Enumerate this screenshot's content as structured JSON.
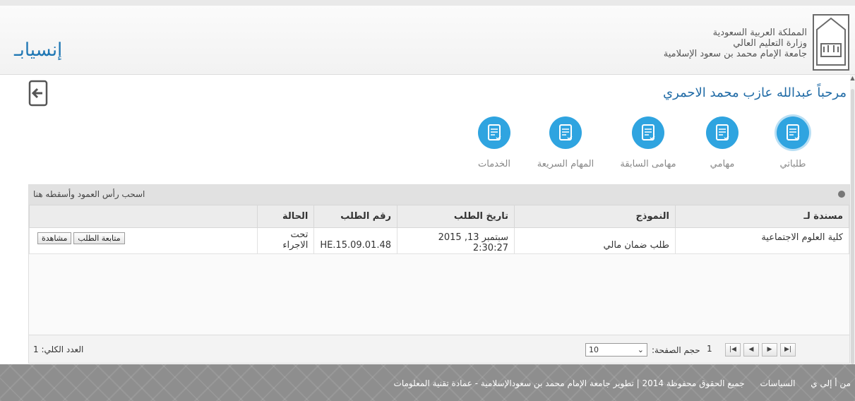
{
  "header": {
    "university_lines": [
      "المملكة العربية السعودية",
      "وزارة التعليم العالي",
      "جامعة الإمام محمد بن سعود الإسلامية"
    ],
    "brand": "إنسيابـ"
  },
  "welcome": "مرحباً عبدالله عازب محمد الاحمري",
  "services": [
    {
      "label": "طلباتي",
      "icon": "document-check-icon"
    },
    {
      "label": "مهامي",
      "icon": "document-check-icon"
    },
    {
      "label": "مهامى السابقة",
      "icon": "document-check-icon"
    },
    {
      "label": "المهام السريعة",
      "icon": "document-check-icon"
    },
    {
      "label": "الخدمات",
      "icon": "document-check-icon"
    }
  ],
  "grid": {
    "group_hint": "اسحب رأس العمود وأسقطه هنا",
    "columns": [
      "مسندة لـ",
      "النموذج",
      "تاريخ الطلب",
      "رقم الطلب",
      "الحالة"
    ],
    "rows": [
      {
        "assigned_to": "كلية العلوم الاجتماعية",
        "form": "طلب ضمان مالي",
        "date": "سبتمبر 13, 2015 2:30:27",
        "number": "HE.15.09.01.48",
        "status": "تحت الاجراء",
        "view_label": "مشاهدة",
        "follow_label": "متابعة الطلب"
      }
    ],
    "pager": {
      "total": "العدد الكلي: 1",
      "page_size_label": "حجم الصفحة:",
      "page_size_value": "10",
      "current_page": "1"
    }
  },
  "footer": {
    "links": [
      "من أ إلى ي",
      "السياسات"
    ],
    "copyright": "جميع الحقوق محفوظة 2014 | تطوير جامعة الإمام محمد بن سعودالإسلامية - عمادة تقنية المعلومات"
  },
  "colors": {
    "accent": "#2fa4e0",
    "welcome": "#1f6aa5",
    "footer": "#8e8e8e"
  }
}
